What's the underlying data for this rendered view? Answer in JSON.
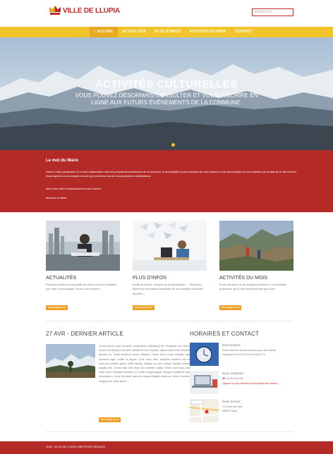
{
  "header": {
    "logo_text": "VILLE DE LLUPIA",
    "search_placeholder": "Recherche..."
  },
  "nav": {
    "items": [
      "ACCUEIL",
      "ACTUALITÉS",
      "PLUS D'INFOS",
      "ACTIVITÉS DU MOIS",
      "CONTACT"
    ],
    "home_icon": "home-icon"
  },
  "hero": {
    "title": "ACTIVITÉS CULTURELLES",
    "subtitle": "VOUS POUVEZ DÉSORMAIS CONSULTER ET VOUS INSCRIRE EN LIGNE AUX FUTURS ÉVÈNEMENTS DE LA COMMUNE."
  },
  "mayor": {
    "title": "Le mot du Maire",
    "p1": "Grâce à votre participation et à votre collaboration dans les précédents évènements de la commune, la municipalité a pris la décision de vous informer et de communiquer sur nos activités par le biais de ce site Internet. Nous espérons vous compter encore plus nombreux lors de nos prochaines manifestations.",
    "p2": "Merci pour votre investissement et votre soutien.",
    "p3": "Monsieur le Maire."
  },
  "cards": [
    {
      "title": "ACTUALITÉS",
      "text": "Retrouvez toutes les actualités de votre commune classées par ordre chronologique. Tenez-vous informé !",
      "button": "EN SAVOIR PLUS"
    },
    {
      "title": "PLUS D'INFOS",
      "text": "Sortie au musée, horaires de la bibliothèque, ... Retrouvez toutes les informations pratiques de vos activités culturelles favorites.",
      "button": "EN SAVOIR PLUS"
    },
    {
      "title": "ACTIVITÉS DU MOIS",
      "text": "Envie d'évasion ou de pratiques sportives ? Les activités proposées par la ville mériteront plus que vous.",
      "button": "EN SAVOIR PLUS"
    }
  ],
  "article": {
    "heading": "27 AVR - DERNIER ARTICLE",
    "text": "Lorem ipsum dolor sit amet, consectetur adipiscing elit. Praesent nec nibh id ornare nisl tempus semper. Nullam et eros blandit, ullamcorper enim lobortis, gravida eu. Nulla faucibus rutrum efficitur. Fusce dolor lorem sodales eget tincidunt eget, mollis ut augue. Cras nunc nibh, tincidunt eleifend nisl at, vehicula porttitor justo. Nulla facilisi. Nullam ac arcu neque. Nullam dictum sagittis sed. Donec sed velit vitae dui molestie mattis. Etiam commodo urna vitae lorem tristique maximus. In mollis feugiat augue, tempus sollicitudin wisi venenatis a. Nunc tincidunt diam ac neque fringilla maximus. Morbi tincidunt congue dui, vitae libero...",
    "button": "EN SAVOIR PLUS"
  },
  "contact": {
    "heading": "HORAIRES ET CONTACT",
    "rows": [
      {
        "title": "Nos horaires",
        "lines": [
          "Nous sommes ouverts tous les jours du lundi au",
          "vendredi de 8 h à 12h et de 14h à 17h"
        ]
      },
      {
        "title": "Nous contacter",
        "lines": [
          "04.68.53.50.96",
          "Cliquez ici pour accéder au formulaire de contact"
        ]
      },
      {
        "title": "Nous trouver",
        "lines": [
          "13 Carrer de l'aire",
          "66300 Llupia"
        ]
      }
    ]
  },
  "footer": {
    "text": "2016 - VILLE DE LLUPIA | MENTIONS LÉGALES"
  },
  "colors": {
    "brand_red": "#b42a27",
    "nav_yellow": "#f2c42c",
    "button_orange": "#f0a024"
  }
}
